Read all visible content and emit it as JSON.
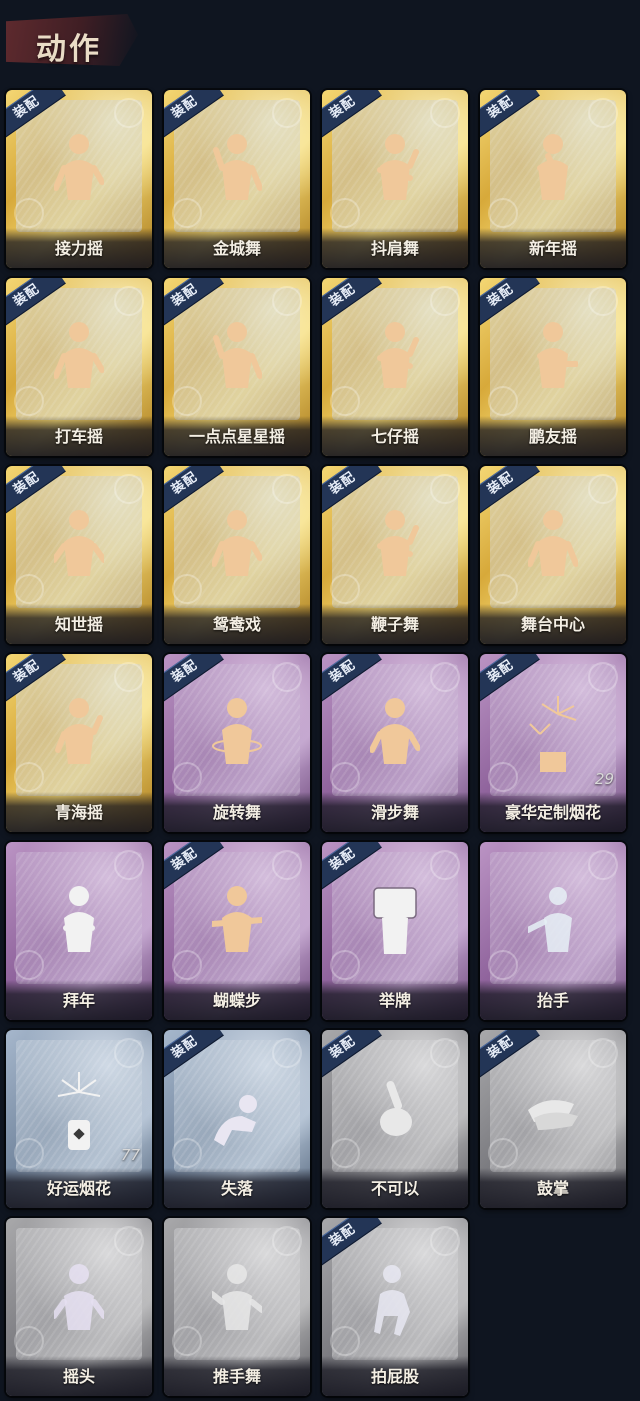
{
  "header": {
    "title": "动作"
  },
  "equip_label": "装配",
  "cards": [
    {
      "name": "接力摇",
      "style": "gold",
      "equipped": true,
      "figure": "tan"
    },
    {
      "name": "金城舞",
      "style": "gold",
      "equipped": true,
      "figure": "tan"
    },
    {
      "name": "抖肩舞",
      "style": "gold",
      "equipped": true,
      "figure": "tan"
    },
    {
      "name": "新年摇",
      "style": "gold",
      "equipped": true,
      "figure": "tan"
    },
    {
      "name": "打车摇",
      "style": "gold",
      "equipped": true,
      "figure": "tan"
    },
    {
      "name": "一点点星星摇",
      "style": "gold",
      "equipped": true,
      "figure": "tan"
    },
    {
      "name": "七仔摇",
      "style": "gold",
      "equipped": true,
      "figure": "tan"
    },
    {
      "name": "鹏友摇",
      "style": "gold",
      "equipped": true,
      "figure": "tan"
    },
    {
      "name": "知世摇",
      "style": "gold",
      "equipped": true,
      "figure": "tan"
    },
    {
      "name": "鸳鸯戏",
      "style": "gold",
      "equipped": true,
      "figure": "tan"
    },
    {
      "name": "鞭子舞",
      "style": "gold",
      "equipped": true,
      "figure": "tan"
    },
    {
      "name": "舞台中心",
      "style": "gold",
      "equipped": true,
      "figure": "tan"
    },
    {
      "name": "青海摇",
      "style": "gold",
      "equipped": true,
      "figure": "tan"
    },
    {
      "name": "旋转舞",
      "style": "purple",
      "equipped": true,
      "figure": "tan"
    },
    {
      "name": "滑步舞",
      "style": "purple",
      "equipped": true,
      "figure": "tan"
    },
    {
      "name": "豪华定制烟花",
      "style": "purple",
      "equipped": true,
      "figure": "firework",
      "count": "29"
    },
    {
      "name": "拜年",
      "style": "purple",
      "equipped": false,
      "figure": "white"
    },
    {
      "name": "蝴蝶步",
      "style": "purple",
      "equipped": true,
      "figure": "tan"
    },
    {
      "name": "举牌",
      "style": "purple",
      "equipped": true,
      "figure": "white"
    },
    {
      "name": "抬手",
      "style": "purple",
      "equipped": false,
      "figure": "white"
    },
    {
      "name": "好运烟花",
      "style": "blue",
      "equipped": false,
      "figure": "firework-white",
      "count": "77"
    },
    {
      "name": "失落",
      "style": "blue",
      "equipped": true,
      "figure": "white"
    },
    {
      "name": "不可以",
      "style": "silver",
      "equipped": true,
      "figure": "white"
    },
    {
      "name": "鼓掌",
      "style": "silver",
      "equipped": true,
      "figure": "white"
    },
    {
      "name": "摇头",
      "style": "silver",
      "equipped": false,
      "figure": "white"
    },
    {
      "name": "推手舞",
      "style": "silver",
      "equipped": false,
      "figure": "white"
    },
    {
      "name": "拍屁股",
      "style": "silver",
      "equipped": true,
      "figure": "white"
    }
  ],
  "colors": {
    "background": "#0f1520",
    "gold": "#d7a93a",
    "purple": "#8f639c",
    "blue": "#74879f",
    "silver": "#7b7b80",
    "equip_badge": "#233556"
  }
}
